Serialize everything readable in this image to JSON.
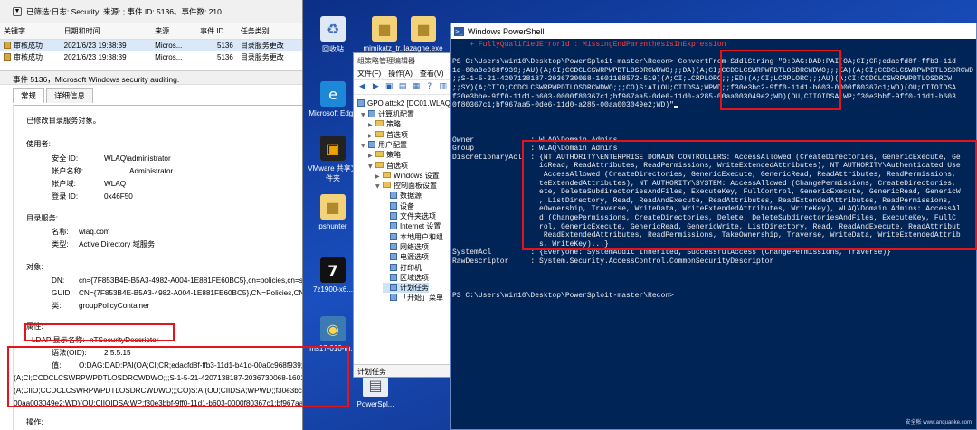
{
  "desktop": {
    "icons": [
      {
        "label": "回收站",
        "icon": "recycle-bin-icon",
        "glyph": "♻"
      },
      {
        "label": "mimikatz_tr...",
        "icon": "folder-icon",
        "glyph": "■"
      },
      {
        "label": "lazagne.exe",
        "icon": "folder-icon",
        "glyph": "■"
      },
      {
        "label": "Microsoft Edge",
        "icon": "edge-icon",
        "glyph": "e"
      },
      {
        "label": "VMware 共享文件夹",
        "icon": "vmware-icon",
        "glyph": "▣"
      },
      {
        "label": "pshunter",
        "icon": "folder-icon",
        "glyph": "■"
      },
      {
        "label": "7z1900-x6...",
        "icon": "seven-zip-icon",
        "glyph": "7"
      },
      {
        "label": "ms17-010-m...",
        "icon": "python-icon",
        "glyph": "◉"
      },
      {
        "label": "PowerSpl...",
        "icon": "file-icon",
        "glyph": "▤"
      }
    ]
  },
  "event_viewer": {
    "filter_text": "已筛选:日志: Security; 来源: ; 事件 ID: 5136。事件数: 210",
    "columns": [
      "关键字",
      "日期和时间",
      "来源",
      "事件 ID",
      "任务类别"
    ],
    "rows": [
      [
        "审核成功",
        "2021/6/23 19:38:39",
        "Micros...",
        "5136",
        "目录服务更改"
      ],
      [
        "审核成功",
        "2021/6/23 19:38:39",
        "Micros...",
        "5136",
        "目录服务更改"
      ]
    ],
    "event_header": "事件 5136，Microsoft Windows security auditing.",
    "tabs": [
      "常规",
      "详细信息"
    ],
    "detail": {
      "intro": "已修改目录服务对象。",
      "subject_heading": "使用者:",
      "subject": [
        {
          "key": "安全 ID:",
          "value": "WLAQ\\administrator"
        },
        {
          "key": "帐户名称:",
          "value": "Administrator"
        },
        {
          "key": "帐户域:",
          "value": "WLAQ"
        },
        {
          "key": "登录 ID:",
          "value": "0x46F50"
        }
      ],
      "directory_heading": "目录服务:",
      "directory": [
        {
          "key": "名称:",
          "value": "wlaq.com"
        },
        {
          "key": "类型:",
          "value": "Active Directory 域服务"
        }
      ],
      "object_heading": "对象:",
      "object": [
        {
          "key": "DN:",
          "value": "cn={7F853B4E-B5A3-4982-A004-1E881FE60BC5},cn=policies,cn=system,DC="
        },
        {
          "key": "GUID:",
          "value": "CN={7F853B4E-B5A3-4982-A004-1E881FE60BC5},CN=Policies,CN=System,D"
        },
        {
          "key": "类:",
          "value": "groupPolicyContainer"
        }
      ],
      "attribute_heading": "属性:",
      "attribute_ldap_key": "LDAP 显示名称:",
      "attribute_ldap_value": "nTSecurityDescriptor",
      "syntax_key": "语法(OID):",
      "syntax_value": "2.5.5.15",
      "value_key": "值:",
      "value_lines": [
        "O:DAG:DAD:PAI(OA;CI;CR;edacfd8f-ffb3-11d1-b41d-00a0c968f939;;AU)(A;CI;",
        "(A;CI;CCDCLCSWRPWPDTLOSDRCWDWO;;;S-1-5-21-4207138187-2036730068-1601168572-5",
        "(A;CIIO;CCDCLCSWRPWPDTLOSDRCWDWO;;;CO)S:AI(OU;CIIDSA;WPWD;;f30e3bc2-9ff0-11d1",
        "00aa003049e2;WD)(OU;CIIOIDSA;WP;f30e3bbf-9ff0-11d1-b603-0000f80367c1;bf967aa5-0de"
      ],
      "operation_heading": "操作:"
    }
  },
  "gpo_editor": {
    "title": "组策略管理编辑器",
    "menu": [
      "文件(F)",
      "操作(A)",
      "查看(V)"
    ],
    "root": "GPO attck2 [DC01.WLAQ",
    "tree": [
      {
        "label": "计算机配置",
        "level": 0,
        "kind": "item",
        "expanded": true
      },
      {
        "label": "策略",
        "level": 1,
        "kind": "folder"
      },
      {
        "label": "首选项",
        "level": 1,
        "kind": "folder"
      },
      {
        "label": "用户配置",
        "level": 0,
        "kind": "item",
        "expanded": true
      },
      {
        "label": "策略",
        "level": 1,
        "kind": "folder"
      },
      {
        "label": "首选项",
        "level": 1,
        "kind": "folder",
        "expanded": true
      },
      {
        "label": "Windows 设置",
        "level": 2,
        "kind": "folder"
      },
      {
        "label": "控制面板设置",
        "level": 2,
        "kind": "folder",
        "expanded": true
      },
      {
        "label": "数据源",
        "level": 3,
        "kind": "item"
      },
      {
        "label": "设备",
        "level": 3,
        "kind": "item"
      },
      {
        "label": "文件夹选项",
        "level": 3,
        "kind": "item"
      },
      {
        "label": "Internet 设置",
        "level": 3,
        "kind": "item"
      },
      {
        "label": "本地用户和组",
        "level": 3,
        "kind": "item"
      },
      {
        "label": "网络选项",
        "level": 3,
        "kind": "item"
      },
      {
        "label": "电源选项",
        "level": 3,
        "kind": "item"
      },
      {
        "label": "打印机",
        "level": 3,
        "kind": "item"
      },
      {
        "label": "区域选项",
        "level": 3,
        "kind": "item"
      },
      {
        "label": "计划任务",
        "level": 3,
        "kind": "item",
        "selected": true
      },
      {
        "label": "「开始」菜单",
        "level": 3,
        "kind": "item"
      }
    ],
    "status": "计划任务"
  },
  "powershell": {
    "title": "Windows PowerShell",
    "lines": [
      {
        "text": "    + FullyQualifiedErrorId : MissingEndParenthesisInExpression",
        "kind": "err"
      },
      {
        "text": "",
        "kind": "out"
      },
      {
        "text": "PS C:\\Users\\win10\\Desktop\\PowerSploit-master\\Recon> ConvertFrom-SddlString \"O:DAG:DAD:PAI(OA;CI;CR;edacfd8f-ffb3-11d",
        "kind": "out"
      },
      {
        "text": "1d-00a0c968f939;;AU)(A;CI;CCDCLCSWRPWPDTLOSDRCWDWO;;;DA)(A;CI;CCDCLCSWRPWPDTLOSDRCWDWO;;;EA)(A;CI;CCDCLCSWRPWPDTLOSDRCWD",
        "kind": "out"
      },
      {
        "text": ";;S-1-5-21-4207138187-2036730068-1601168572-519)(A;CI;LCRPLORC;;;ED)(A;CI;LCRPLORC;;;AU)(A;CI;CCDCLCSWRPWPDTLOSDRCW",
        "kind": "out"
      },
      {
        "text": ";;SY)(A;CIIO;CCDCLCSWRPWPDTLOSDRCWDWO;;;CO)S:AI(OU;CIIDSA;WPWD;;f30e3bc2-9ff0-11d1-b603-0000f80367c1;WD)(OU;CIIOIDSA",
        "kind": "out"
      },
      {
        "text": "f30e3bbe-9ff0-11d1-b603-0000f80367c1;bf967aa5-0de6-11d0-a285-00aa003049e2;WD)(OU;CIIOIDSA;WP;f30e3bbf-9ff0-11d1-b603",
        "kind": "out"
      },
      {
        "text": "0f80367c1;bf967aa5-0de6-11d0-a285-00aa003049e2;WD)\"",
        "kind": "out",
        "cursor": true
      },
      {
        "text": "",
        "kind": "out"
      },
      {
        "text": "",
        "kind": "out"
      },
      {
        "text": "",
        "kind": "out"
      },
      {
        "text": "Owner             : WLAQ\\Domain Admins",
        "kind": "out"
      },
      {
        "text": "Group             : WLAQ\\Domain Admins",
        "kind": "out"
      },
      {
        "text": "DiscretionaryAcl  : {NT AUTHORITY\\ENTERPRISE DOMAIN CONTROLLERS: AccessAllowed (CreateDirectories, GenericExecute, Ge",
        "kind": "out"
      },
      {
        "text": "                    icRead, ReadAttributes, ReadPermissions, WriteExtendedAttributes), NT AUTHORITY\\Authenticated Use",
        "kind": "out"
      },
      {
        "text": "                     AccessAllowed (CreateDirectories, GenericExecute, GenericRead, ReadAttributes, ReadPermissions,",
        "kind": "out"
      },
      {
        "text": "                    teExtendedAttributes), NT AUTHORITY\\SYSTEM: AccessAllowed (ChangePermissions, CreateDirectories,",
        "kind": "out"
      },
      {
        "text": "                    ete, DeleteSubdirectoriesAndFiles, ExecuteKey, FullControl, GenericExecute, GenericRead, GenericW",
        "kind": "out"
      },
      {
        "text": "                    , ListDirectory, Read, ReadAndExecute, ReadAttributes, ReadExtendedAttributes, ReadPermissions,",
        "kind": "out"
      },
      {
        "text": "                    eOwnership, Traverse, WriteData, WriteExtendedAttributes, WriteKey), WLAQ\\Domain Admins: AccessAl",
        "kind": "out"
      },
      {
        "text": "                    d (ChangePermissions, CreateDirectories, Delete, DeleteSubdirectoriesAndFiles, ExecuteKey, FullC",
        "kind": "out"
      },
      {
        "text": "                    rol, GenericExecute, GenericRead, GenericWrite, ListDirectory, Read, ReadAndExecute, ReadAttribut",
        "kind": "out"
      },
      {
        "text": "                     ReadExtendedAttributes, ReadPermissions, TakeOwnership, Traverse, WriteData, WriteExtendedAttrib",
        "kind": "out"
      },
      {
        "text": "                    s, WriteKey)...}",
        "kind": "out"
      },
      {
        "text": "SystemAcl         : {Everyone: SystemAudit Inherited, SuccessfulAccess (ChangePermissions, Traverse)}",
        "kind": "out"
      },
      {
        "text": "RawDescriptor     : System.Security.AccessControl.CommonSecurityDescriptor",
        "kind": "out"
      },
      {
        "text": "",
        "kind": "out"
      },
      {
        "text": "",
        "kind": "out"
      },
      {
        "text": "",
        "kind": "out"
      },
      {
        "text": "PS C:\\Users\\win10\\Desktop\\PowerSploit-master\\Recon>",
        "kind": "out"
      }
    ]
  },
  "watermark": "安全帐 www.anquanke.com",
  "colors": {
    "annotation_red": "#e5141b",
    "ps_background": "#012456",
    "ps_error": "#ff4040",
    "desktop_blue": "#1a4fbf"
  }
}
